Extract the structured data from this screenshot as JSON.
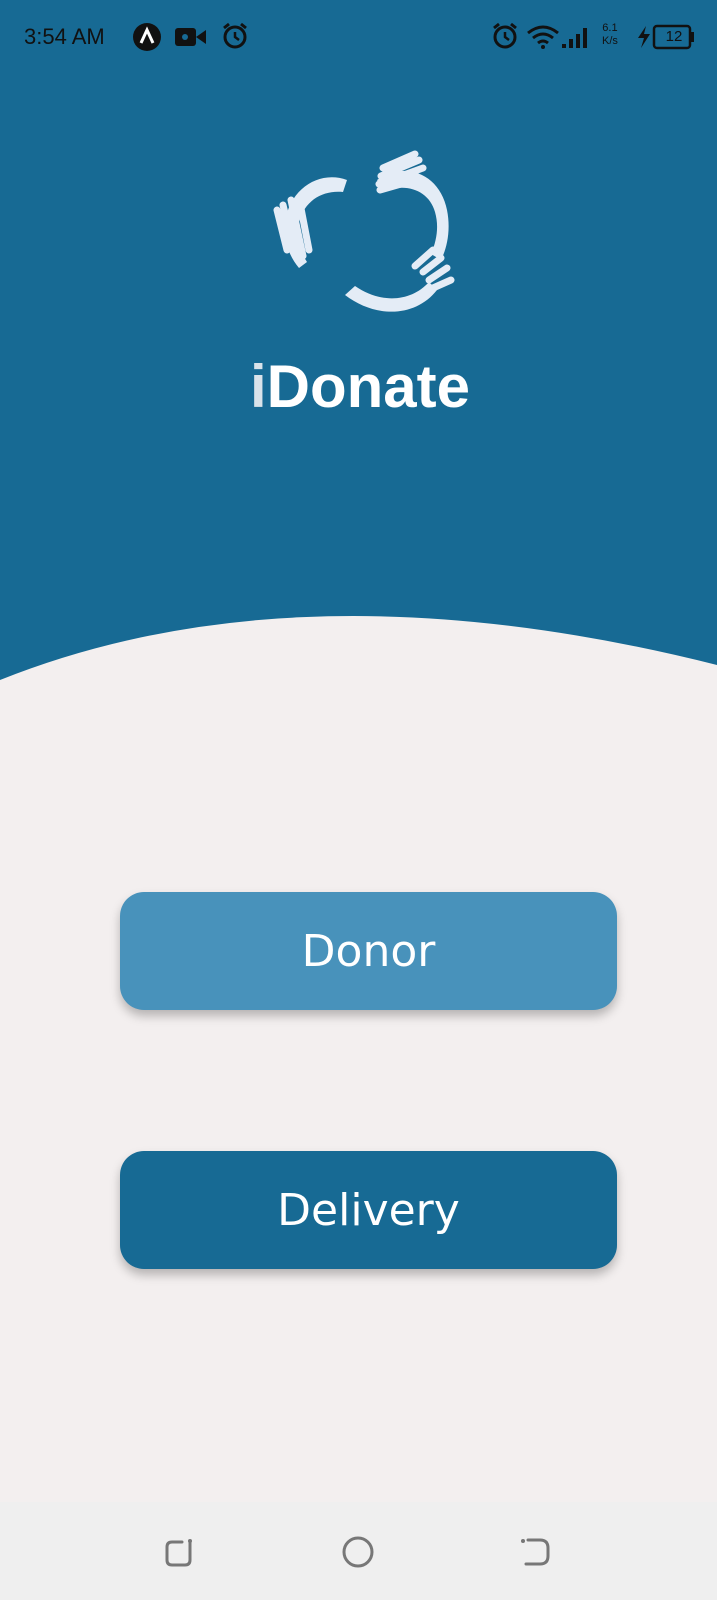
{
  "status_bar": {
    "time": "3:54 AM",
    "net_speed_value": "6.1",
    "net_speed_unit": "K/s",
    "battery_level": "12",
    "icons": [
      "app-notification-icon",
      "video-camera-icon",
      "alarm-icon",
      "alarm-icon",
      "wifi-icon",
      "signal-icon",
      "charging-icon",
      "battery-icon"
    ]
  },
  "app": {
    "brand_i": "i",
    "brand_rest": "Donate",
    "logo": "hands-heart-logo"
  },
  "buttons": {
    "donor": "Donor",
    "delivery": "Delivery"
  },
  "nav": {
    "icons": [
      "recent-apps-icon",
      "home-icon",
      "back-icon"
    ]
  },
  "colors": {
    "header": "#176a94",
    "background": "#f3efef",
    "donor_button": "#4892bb",
    "delivery_button": "#176a94"
  }
}
